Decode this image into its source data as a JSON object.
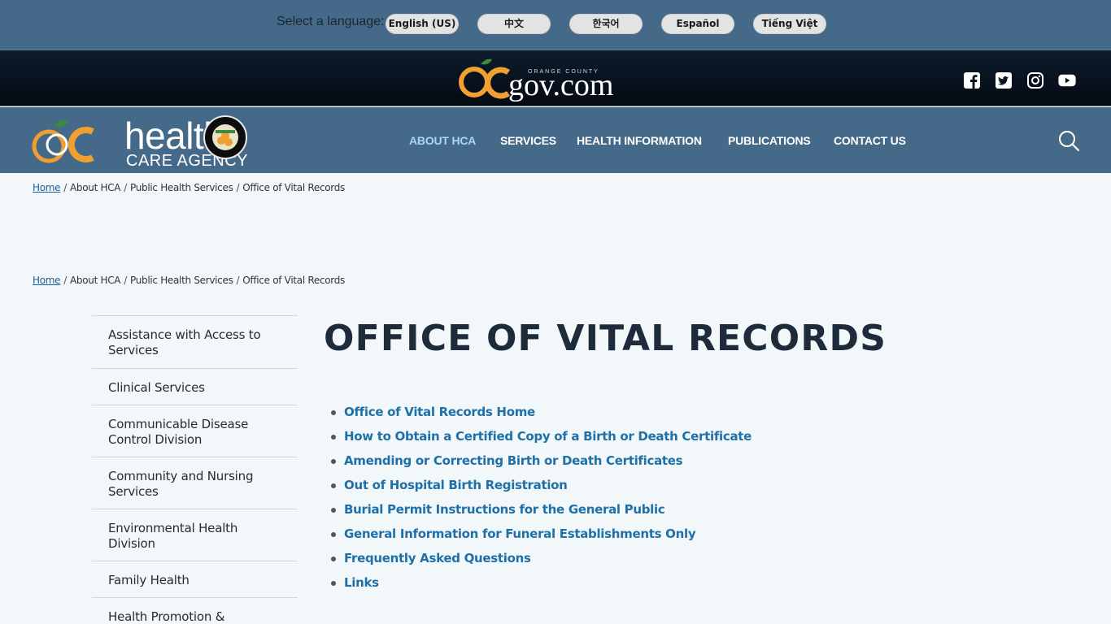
{
  "language_bar": {
    "label": "Select a language:",
    "options": [
      "English (US)",
      "中文",
      "한국어",
      "Español",
      "Tiếng Việt"
    ]
  },
  "gov_header": {
    "logo_text": "gov.com",
    "logo_small": "ORANGE COUNTY",
    "social_icons": [
      "facebook-icon",
      "twitter-icon",
      "instagram-icon",
      "youtube-icon"
    ]
  },
  "hca_header": {
    "logo_main": "health",
    "logo_sub": "CARE AGENCY",
    "nav": [
      "ABOUT HCA",
      "SERVICES",
      "HEALTH INFORMATION",
      "PUBLICATIONS",
      "CONTACT US"
    ],
    "active_nav": "ABOUT HCA"
  },
  "breadcrumb": {
    "home": "Home",
    "items": [
      "About HCA",
      "Public Health Services",
      "Office of Vital Records"
    ],
    "separator": "/"
  },
  "sidebar": {
    "items": [
      "Assistance with Access to Services",
      "Clinical Services",
      "Communicable Disease Control Division",
      "Community and Nursing Services",
      "Environmental Health Division",
      "Family Health",
      "Health Promotion &"
    ]
  },
  "main": {
    "title": "OFFICE OF VITAL RECORDS",
    "links": [
      "Office of Vital Records Home",
      "How to Obtain a Certified Copy of a Birth or Death Certificate",
      "Amending or Correcting Birth or Death Certificates",
      "Out of Hospital Birth Registration",
      "Burial Permit Instructions for the General Public",
      "General Information for Funeral Establishments Only",
      "Frequently Asked Questions",
      "Links"
    ]
  },
  "colors": {
    "header_blue": "#456a89",
    "nav_active": "#a9d7ee",
    "link_blue": "#1f6fa8",
    "orange": "#f0a030"
  }
}
